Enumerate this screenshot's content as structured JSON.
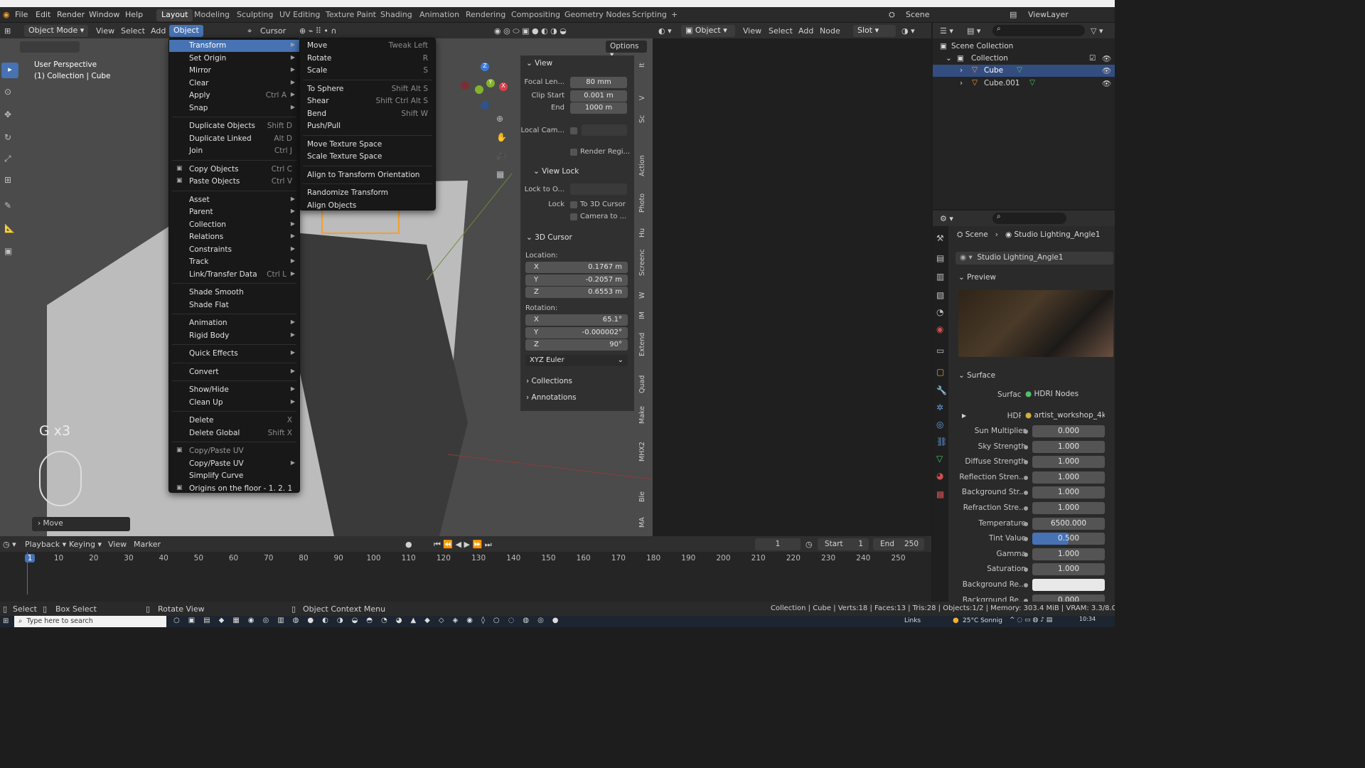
{
  "topmenu": [
    "File",
    "Edit",
    "Render",
    "Window",
    "Help"
  ],
  "workspaces": [
    "Layout",
    "Modeling",
    "Sculpting",
    "UV Editing",
    "Texture Paint",
    "Shading",
    "Animation",
    "Rendering",
    "Compositing",
    "Geometry Nodes",
    "Scripting",
    "+"
  ],
  "scene_label": "Scene",
  "viewlayer_label": "ViewLayer",
  "viewport_header": {
    "mode": "Object Mode",
    "menus": [
      "View",
      "Select",
      "Add",
      "Object"
    ],
    "pivot": "Cursor",
    "options": "Options"
  },
  "viewport_info": {
    "line1": "User Perspective",
    "line2": "(1) Collection | Cube"
  },
  "op_overlay": {
    "text": "G x3",
    "last_op": "Move"
  },
  "object_menu": [
    {
      "label": "Transform",
      "submenu": true,
      "highlight": true
    },
    {
      "label": "Set Origin",
      "submenu": true
    },
    {
      "label": "Mirror",
      "submenu": true
    },
    {
      "label": "Clear",
      "submenu": true
    },
    {
      "label": "Apply",
      "shortcut": "Ctrl A",
      "submenu": true
    },
    {
      "label": "Snap",
      "submenu": true
    },
    {
      "sep": true
    },
    {
      "label": "Duplicate Objects",
      "shortcut": "Shift D"
    },
    {
      "label": "Duplicate Linked",
      "shortcut": "Alt D"
    },
    {
      "label": "Join",
      "shortcut": "Ctrl J"
    },
    {
      "sep": true
    },
    {
      "label": "Copy Objects",
      "shortcut": "Ctrl C",
      "icon": true
    },
    {
      "label": "Paste Objects",
      "shortcut": "Ctrl V",
      "icon": true
    },
    {
      "sep": true
    },
    {
      "label": "Asset",
      "submenu": true
    },
    {
      "label": "Parent",
      "submenu": true
    },
    {
      "label": "Collection",
      "submenu": true
    },
    {
      "label": "Relations",
      "submenu": true
    },
    {
      "label": "Constraints",
      "submenu": true
    },
    {
      "label": "Track",
      "submenu": true
    },
    {
      "label": "Link/Transfer Data",
      "shortcut": "Ctrl L",
      "submenu": true
    },
    {
      "sep": true
    },
    {
      "label": "Shade Smooth"
    },
    {
      "label": "Shade Flat"
    },
    {
      "sep": true
    },
    {
      "label": "Animation",
      "submenu": true
    },
    {
      "label": "Rigid Body",
      "submenu": true
    },
    {
      "sep": true
    },
    {
      "label": "Quick Effects",
      "submenu": true
    },
    {
      "sep": true
    },
    {
      "label": "Convert",
      "submenu": true
    },
    {
      "sep": true
    },
    {
      "label": "Show/Hide",
      "submenu": true
    },
    {
      "label": "Clean Up",
      "submenu": true
    },
    {
      "sep": true
    },
    {
      "label": "Delete",
      "shortcut": "X"
    },
    {
      "label": "Delete Global",
      "shortcut": "Shift X"
    },
    {
      "sep": true
    },
    {
      "label": "Copy/Paste UV",
      "disabled": true,
      "icon": true
    },
    {
      "label": "Copy/Paste UV",
      "submenu": true
    },
    {
      "label": "Simplify Curve"
    },
    {
      "label": "Origins on the floor - 1. 2. 1",
      "icon": true
    }
  ],
  "transform_menu": [
    {
      "label": "Move",
      "shortcut": "Tweak Left"
    },
    {
      "label": "Rotate",
      "shortcut": "R"
    },
    {
      "label": "Scale",
      "shortcut": "S"
    },
    {
      "sep": true
    },
    {
      "label": "To Sphere",
      "shortcut": "Shift Alt S"
    },
    {
      "label": "Shear",
      "shortcut": "Shift Ctrl Alt S"
    },
    {
      "label": "Bend",
      "shortcut": "Shift W"
    },
    {
      "label": "Push/Pull"
    },
    {
      "sep": true
    },
    {
      "label": "Move Texture Space"
    },
    {
      "label": "Scale Texture Space"
    },
    {
      "sep": true
    },
    {
      "label": "Align to Transform Orientation"
    },
    {
      "sep": true
    },
    {
      "label": "Randomize Transform"
    },
    {
      "label": "Align Objects"
    }
  ],
  "npanel": {
    "view_title": "View",
    "focal_label": "Focal Len...",
    "focal": "80 mm",
    "clip_start_label": "Clip Start",
    "clip_start": "0.001 m",
    "end_label": "End",
    "clip_end": "1000 m",
    "local_cam_label": "Local Cam...",
    "render_region": "Render Regi...",
    "view_lock_title": "View Lock",
    "lock_to_label": "Lock to O...",
    "lock_label": "Lock",
    "to_3d_cursor": "To 3D Cursor",
    "camera_to": "Camera to ...",
    "cursor_title": "3D Cursor",
    "location_label": "Location:",
    "loc": [
      {
        "axis": "X",
        "value": "0.1767 m"
      },
      {
        "axis": "Y",
        "value": "-0.2057 m"
      },
      {
        "axis": "Z",
        "value": "0.6553 m"
      }
    ],
    "rotation_label": "Rotation:",
    "rot": [
      {
        "axis": "X",
        "value": "65.1°"
      },
      {
        "axis": "Y",
        "value": "-0.000002°"
      },
      {
        "axis": "Z",
        "value": "90°"
      }
    ],
    "rot_mode": "XYZ Euler",
    "collections": "Collections",
    "annotations": "Annotations"
  },
  "vtabs": [
    "It",
    "V",
    "Sc",
    "Action",
    "Photo",
    "Hu",
    "Screenc",
    "W",
    "IM",
    "Extend",
    "Quad",
    "Make",
    "MHX2",
    "Ble",
    "MA"
  ],
  "node_header": {
    "menu": [
      "Object",
      "View",
      "Select",
      "Add",
      "Node"
    ],
    "slot": "Slot"
  },
  "outliner": {
    "root": "Scene Collection",
    "collection": "Collection",
    "items": [
      "Cube",
      "Cube.001"
    ]
  },
  "properties": {
    "breadcrumb": [
      "Scene",
      "Studio Lighting_Angle1"
    ],
    "world_name": "Studio Lighting_Angle1",
    "preview": "Preview",
    "surface_section": "Surface",
    "surface_label": "Surface",
    "surface_value": "HDRI Nodes",
    "hdri_label": "HDRI",
    "hdri_value": "artist_workshop_4k....",
    "rows": [
      {
        "label": "Sun Multiplier",
        "value": "0.000"
      },
      {
        "label": "Sky Strength",
        "value": "1.000"
      },
      {
        "label": "Diffuse Strength",
        "value": "1.000"
      },
      {
        "label": "Reflection Stren...",
        "value": "1.000"
      },
      {
        "label": "Background Str...",
        "value": "1.000"
      },
      {
        "label": "Refraction Stre...",
        "value": "1.000"
      },
      {
        "label": "Temperature",
        "value": "6500.000"
      },
      {
        "label": "Tint Value",
        "value": "0.500",
        "fill": 0.5
      },
      {
        "label": "Gamma",
        "value": "1.000"
      },
      {
        "label": "Saturation",
        "value": "1.000"
      },
      {
        "label": "Background Re...",
        "value": ""
      },
      {
        "label": "Background Re...",
        "value": "0.000"
      }
    ]
  },
  "timeline": {
    "menus": [
      "Playback",
      "Keying",
      "View",
      "Marker"
    ],
    "current": "1",
    "start_label": "Start",
    "start": "1",
    "end_label": "End",
    "end": "250",
    "ticks": [
      "1",
      "10",
      "20",
      "30",
      "40",
      "50",
      "60",
      "70",
      "80",
      "90",
      "100",
      "110",
      "120",
      "130",
      "140",
      "150",
      "160",
      "170",
      "180",
      "190",
      "200",
      "210",
      "220",
      "230",
      "240",
      "250"
    ]
  },
  "status": {
    "select": "Select",
    "box_select": "Box Select",
    "rotate_view": "Rotate View",
    "context": "Object Context Menu",
    "info": "Collection | Cube | Verts:18 | Faces:13 | Tris:28 | Objects:1/2 | Memory: 303.4 MiB | VRAM: 3.3/8.0 GiB | 3.0"
  },
  "taskbar": {
    "search": "Type here to search",
    "links": "Links",
    "weather": "25°C Sonnig",
    "time": "10:34"
  },
  "colors": {
    "accent": "#4772b3",
    "selection": "#334d80",
    "orange": "#f0a030"
  }
}
